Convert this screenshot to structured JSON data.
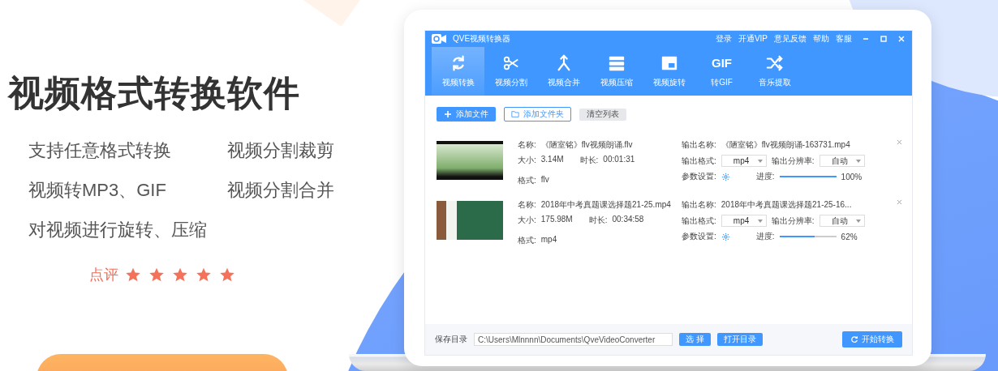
{
  "hero": {
    "title": "视频格式转换软件",
    "features": [
      "支持任意格式转换",
      "视频分割裁剪",
      "视频转MP3、GIF",
      "视频分割合并",
      "对视频进行旋转、压缩"
    ],
    "rating": {
      "label": "点评",
      "stars": 5
    }
  },
  "app": {
    "title": "QVE视频转换器",
    "top_links": [
      "登录",
      "开通VIP",
      "意见反馈",
      "帮助",
      "客服"
    ],
    "tabs": [
      {
        "label": "视频转换",
        "selected": true
      },
      {
        "label": "视频分割",
        "selected": false
      },
      {
        "label": "视频合并",
        "selected": false
      },
      {
        "label": "视频压缩",
        "selected": false
      },
      {
        "label": "视频旋转",
        "selected": false
      },
      {
        "label": "转GIF",
        "icon_text": "GIF",
        "selected": false
      },
      {
        "label": "音乐提取",
        "selected": false
      }
    ],
    "toolbar": [
      {
        "label": "添加文件",
        "kind": "primary"
      },
      {
        "label": "添加文件夹",
        "kind": "outline"
      },
      {
        "label": "清空列表",
        "kind": "plain"
      }
    ],
    "files": [
      {
        "name_label": "名称:",
        "name": "《陋室铭》flv视频朗诵.flv",
        "size_label": "大小:",
        "size": "3.14M",
        "duration_label": "时长:",
        "duration": "00:01:31",
        "format_label": "格式:",
        "format": "flv",
        "output_name_label": "输出名称:",
        "output_name": "《陋室铭》flv视频朗诵-163731.mp4",
        "output_format_label": "输出格式:",
        "output_format": "mp4",
        "resolution_label": "输出分辨率:",
        "resolution": "自动",
        "params_label": "参数设置:",
        "progress_label": "进度:",
        "level": 1,
        "reading": "100%"
      },
      {
        "name_label": "名称:",
        "name": "2018年中考真题课选择题21-25.mp4",
        "size_label": "大小:",
        "size": "175.98M",
        "duration_label": "时长:",
        "duration": "00:34:58",
        "format_label": "格式:",
        "format": "mp4",
        "output_name_label": "输出名称:",
        "output_name": "2018年中考真题课选择题21-25-16...",
        "output_format_label": "输出格式:",
        "output_format": "mp4",
        "resolution_label": "输出分辨率:",
        "resolution": "自动",
        "params_label": "参数设置:",
        "progress_label": "进度:",
        "level": 0.62,
        "reading": "62%"
      }
    ],
    "bottom": {
      "label": "保存目录",
      "path": "C:\\Users\\Mlnnnn\\Documents\\QveVideoConverter",
      "choose": "选 择",
      "open": "打开目录",
      "start": "开始转换"
    }
  }
}
